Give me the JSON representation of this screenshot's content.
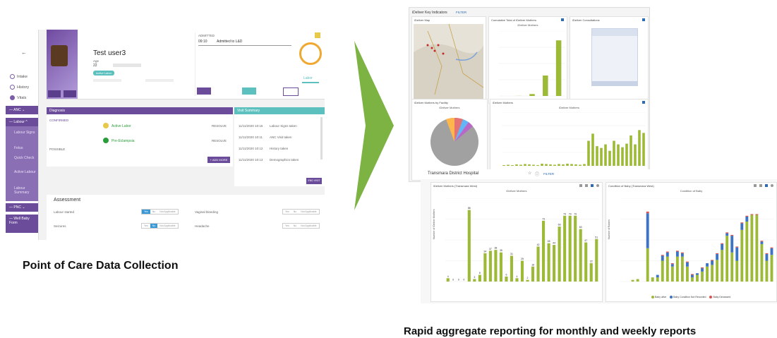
{
  "poc": {
    "nav": {
      "back": "←",
      "steps": [
        "Intake",
        "History",
        "Vitals"
      ],
      "groups": [
        "ANC",
        "Labour",
        "PNC",
        "Well Baby Form"
      ],
      "labour_items": [
        "Labour Signs",
        "Fetus",
        "Quick Check",
        "Active Labour",
        "Labour Summary"
      ]
    },
    "patient": {
      "name": "Test user3",
      "age_label": "Age",
      "age": "22",
      "status_pill": "Active Labor"
    },
    "admitted": {
      "label": "ADMITTED",
      "time": "09:10",
      "text": "Admitted to L&D"
    },
    "gauge": {
      "state": "Labor"
    },
    "diagnosis": {
      "title": "Diagnosis",
      "confirmed_label": "CONFIRMED",
      "possible_label": "POSSIBLE",
      "rows": [
        {
          "name": "Active Labor",
          "action": "RESOLVE"
        },
        {
          "name": "Pre-Eclampsia",
          "action": "RESOLVE"
        }
      ],
      "add_button": "+ ADD MORE"
    },
    "visit_summary": {
      "title": "Visit Summary",
      "entries": [
        {
          "time": "11/11/2020 10:15",
          "text": "Labour Signs taken"
        },
        {
          "time": "11/11/2020 10:11",
          "text": "ANC Visit taken"
        },
        {
          "time": "11/11/2020 10:12",
          "text": "History taken"
        },
        {
          "time": "11/11/2020 10:13",
          "text": "Demographics taken"
        }
      ],
      "end_button": "END VISIT"
    },
    "assessment": {
      "title": "Assessment",
      "rows": [
        {
          "label": "Labour started",
          "selected": "Yes"
        },
        {
          "label": "Seizures",
          "selected": "No"
        },
        {
          "label": "Vaginal bleeding",
          "selected": ""
        },
        {
          "label": "Headache",
          "selected": ""
        }
      ],
      "options": [
        "Yes",
        "No",
        "Not Applicable"
      ]
    }
  },
  "captions": {
    "left": "Point of Care Data Collection",
    "right": "Rapid aggregate reporting for monthly and weekly reports"
  },
  "dashboard_top": {
    "title": "iDeliver Key Indicators",
    "filter": "FILTER",
    "cards": {
      "map": "iDeliver Map",
      "cumulative": "Cumulative Total of iDeliver Mothers",
      "cumulative_sub": "iDeliver Mothers",
      "consultations": "iDeliver Consultations",
      "facility": "iDeliver Mothers by Facility",
      "facility_sub": "iDeliver Mothers",
      "monthly": "iDeliver Mothers",
      "monthly_sub": "iDeliver Mothers"
    }
  },
  "dashboard_bottom": {
    "hospital": "Transmara District Hospital",
    "filter": "FILTER",
    "left_card_title": "iDeliver Mothers (Transmara West)",
    "left_card_sub": "iDeliver Mothers",
    "left_ylabel": "Number of iDeliver Mothers",
    "right_card_title": "Condition of Baby (Transmara West)",
    "right_card_sub": "Condition of Baby",
    "right_ylabel": "Number of Babies",
    "legend": [
      {
        "name": "Baby alive",
        "color": "#9cba38"
      },
      {
        "name": "Baby Condition Not Recorded",
        "color": "#3d73c4"
      },
      {
        "name": "Baby Deceased",
        "color": "#d9534f"
      }
    ]
  },
  "chart_data": [
    {
      "type": "bar",
      "title": "iDeliver Mothers",
      "ylabel": "Number of iDeliver Mothers",
      "ylim": [
        0,
        100
      ],
      "values": [
        4,
        0,
        0,
        0,
        86,
        3,
        8,
        34,
        37,
        38,
        35,
        6,
        31,
        4,
        25,
        2,
        18,
        42,
        73,
        46,
        44,
        66,
        79,
        79,
        79,
        63,
        47,
        22,
        51
      ],
      "labels": [
        "4",
        "0",
        "0",
        "0",
        "86",
        "3",
        "8",
        "34",
        "37",
        "38",
        "35",
        "6",
        "31",
        "4",
        "25",
        "2",
        "18",
        "42",
        "73",
        "46",
        "44",
        "66",
        "79",
        "79",
        "79",
        "63",
        "47",
        "22",
        "51"
      ]
    },
    {
      "type": "bar",
      "title": "Condition of Baby",
      "ylabel": "Number of Babies",
      "ylim": [
        0,
        100
      ],
      "series": [
        {
          "name": "Baby alive",
          "values": [
            0,
            0,
            2,
            3,
            0,
            40,
            5,
            5,
            25,
            30,
            18,
            30,
            30,
            18,
            5,
            8,
            12,
            18,
            20,
            26,
            38,
            55,
            35,
            25,
            62,
            72,
            80,
            80,
            45,
            25,
            32
          ]
        },
        {
          "name": "Baby Condition Not Recorded",
          "values": [
            0,
            0,
            0,
            0,
            0,
            42,
            0,
            3,
            6,
            5,
            3,
            6,
            4,
            5,
            3,
            2,
            4,
            4,
            5,
            7,
            7,
            3,
            20,
            16,
            8,
            6,
            0,
            0,
            3,
            8,
            8
          ]
        },
        {
          "name": "Baby Deceased",
          "values": [
            0,
            0,
            0,
            0,
            0,
            2,
            0,
            0,
            1,
            1,
            1,
            1,
            1,
            1,
            1,
            0,
            1,
            0,
            1,
            1,
            1,
            1,
            1,
            1,
            1,
            1,
            1,
            1,
            1,
            1,
            1
          ]
        }
      ]
    },
    {
      "type": "bar",
      "title": "iDeliver Mothers",
      "ylabel": "Cumulative Total of iDeliver Mothers",
      "ylim": [
        0,
        1400
      ],
      "values": [
        0,
        2,
        41,
        441,
        1199
      ]
    },
    {
      "type": "bar",
      "title": "iDeliver Mothers",
      "ylim": [
        0,
        150
      ],
      "values": [
        2,
        3,
        2,
        4,
        3,
        5,
        4,
        3,
        2,
        6,
        5,
        4,
        3,
        5,
        4,
        6,
        5,
        4,
        3,
        5,
        70,
        90,
        55,
        50,
        60,
        42,
        70,
        60,
        52,
        62,
        85,
        60,
        100,
        92
      ]
    }
  ]
}
